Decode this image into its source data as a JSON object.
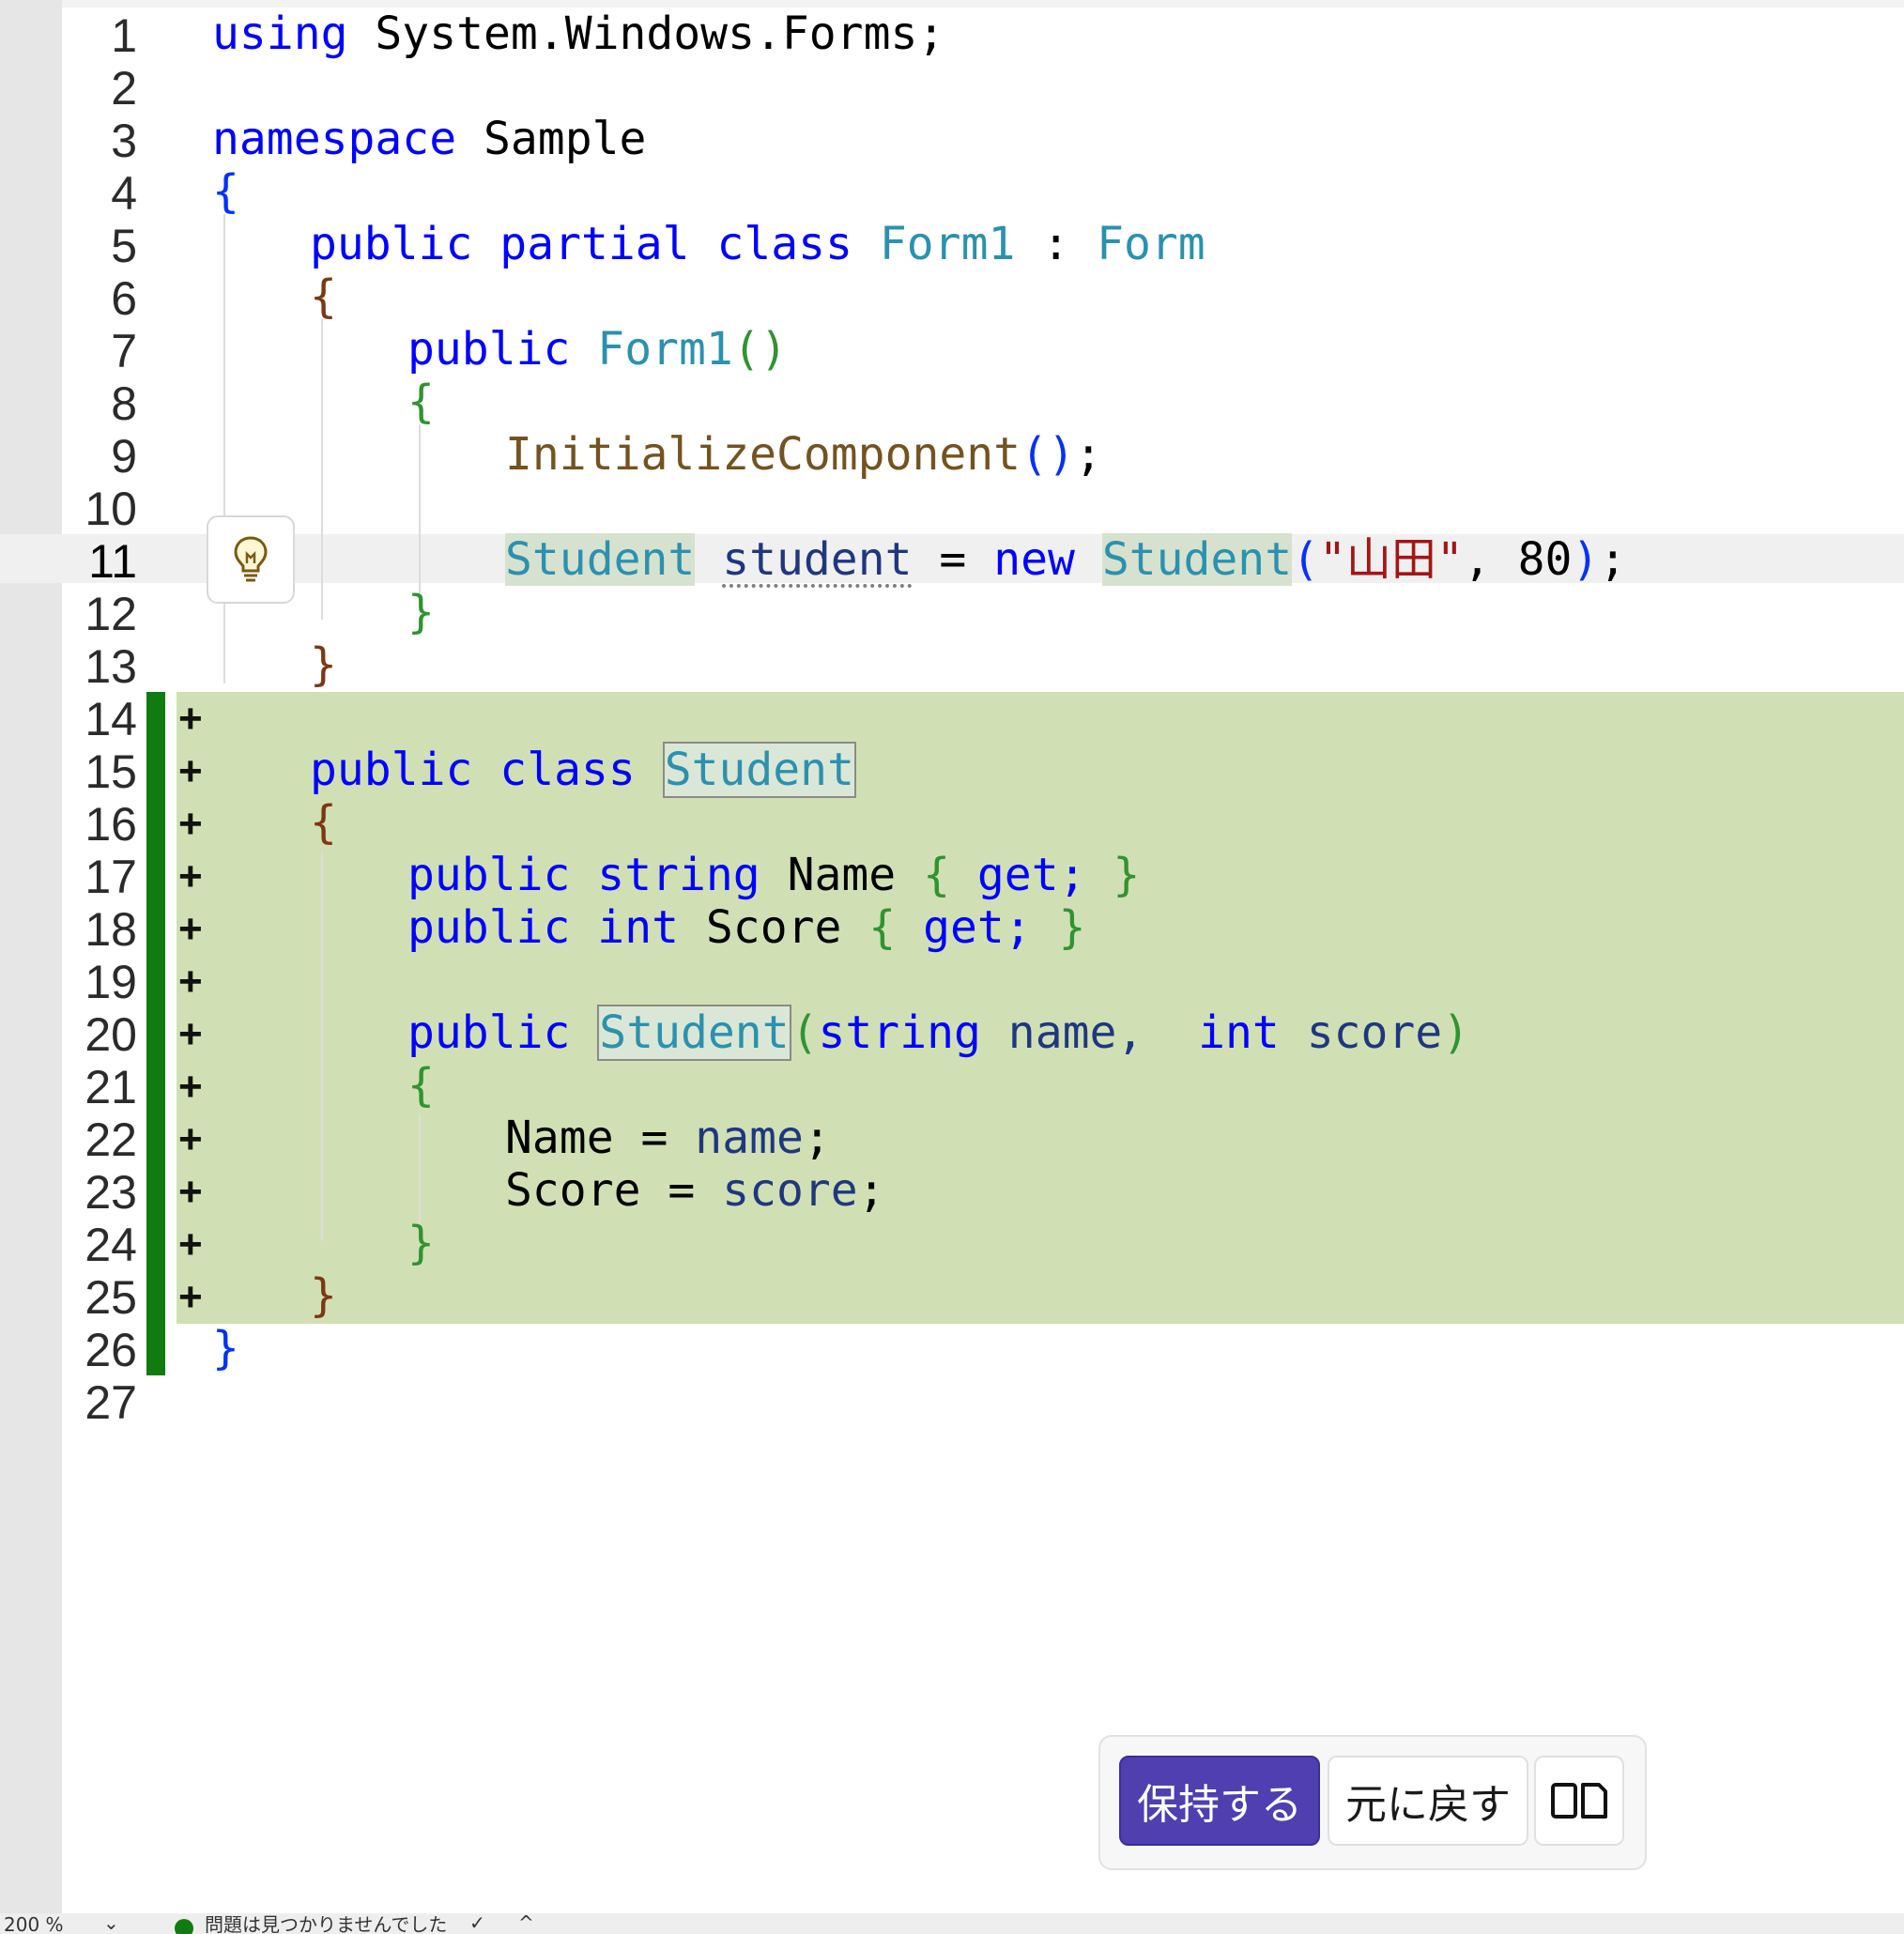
{
  "editor": {
    "line_numbers": [
      "1",
      "2",
      "3",
      "4",
      "5",
      "6",
      "7",
      "8",
      "9",
      "10",
      "11",
      "12",
      "13",
      "14",
      "15",
      "16",
      "17",
      "18",
      "19",
      "20",
      "21",
      "22",
      "23",
      "24",
      "25",
      "26",
      "27"
    ],
    "current_line": "11",
    "added_marker": "+",
    "code": {
      "l1": {
        "kw": "using",
        "rest": " System.Windows.Forms;"
      },
      "l3": {
        "kw": "namespace",
        "rest": " Sample"
      },
      "l4": {
        "brace": "{"
      },
      "l5": {
        "kw": "public partial class",
        "type1": "Form1",
        "sep": " : ",
        "type2": "Form"
      },
      "l6": {
        "brace": "{"
      },
      "l7": {
        "kw": "public",
        "type": "Form1",
        "parens": "()"
      },
      "l8": {
        "brace": "{"
      },
      "l9": {
        "fn": "InitializeComponent",
        "parens": "()",
        "semi": ";"
      },
      "l11": {
        "type1": "Student",
        "var": "student",
        "op": " = ",
        "kw": "new",
        "type2": "Student",
        "open": "(",
        "str": "\"山田\"",
        "comma": ", ",
        "num": "80",
        "close": ")",
        "semi": ";"
      },
      "l12": {
        "brace": "}"
      },
      "l13": {
        "brace": "}"
      },
      "l15": {
        "kw": "public class",
        "type": "Student"
      },
      "l16": {
        "brace": "{"
      },
      "l17": {
        "kw": "public string",
        "name": "Name",
        "ob": "{",
        "acc": "get;",
        "cb": "}"
      },
      "l18": {
        "kw": "public int",
        "name": "Score",
        "ob": "{",
        "acc": "get;",
        "cb": "}"
      },
      "l20": {
        "kw": "public",
        "type": "Student",
        "open": "(",
        "p1t": "string",
        "p1n": "name,",
        "p2t": "int",
        "p2n": "score",
        "close": ")"
      },
      "l21": {
        "brace": "{"
      },
      "l22": {
        "lhs": "Name",
        "op": " = ",
        "rhs": "name",
        "semi": ";"
      },
      "l23": {
        "lhs": "Score",
        "op": " = ",
        "rhs": "score",
        "semi": ";"
      },
      "l24": {
        "brace": "}"
      },
      "l25": {
        "brace": "}"
      },
      "l26": {
        "brace": "}"
      }
    }
  },
  "actions": {
    "keep_label": "保持する",
    "undo_label": "元に戻す",
    "compare_icon": "diff-compare-icon"
  },
  "status_bar": {
    "zoom": "200 %",
    "issues": "問題は見つかりませんでした",
    "up_arrow": "^"
  },
  "colors": {
    "keyword": "#0000ff",
    "type": "#2b91af",
    "method": "#74531f",
    "string": "#a31515",
    "diff_added_bg": "#d1e0b4",
    "diff_bar": "#107c10",
    "keep_button": "#4f3fb0"
  }
}
